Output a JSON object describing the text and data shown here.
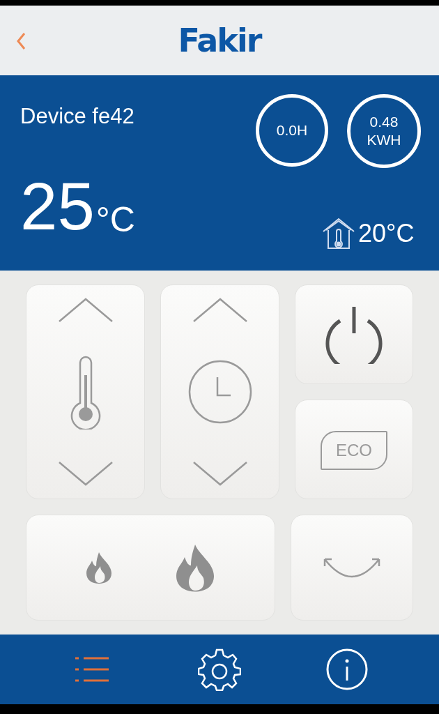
{
  "header": {
    "logo": "Fakir"
  },
  "status": {
    "device_name": "Device fe42",
    "timer": {
      "value": "0.0H"
    },
    "energy": {
      "value": "0.48",
      "unit": "KWH"
    },
    "temperature": "25",
    "temperature_unit": "°C",
    "room_temperature": "20°C"
  },
  "controls": {
    "eco_label": "ECO"
  },
  "bottom_nav": [
    {
      "kind": "list",
      "selected": true
    },
    {
      "kind": "settings",
      "selected": false
    },
    {
      "kind": "info",
      "selected": false
    }
  ]
}
